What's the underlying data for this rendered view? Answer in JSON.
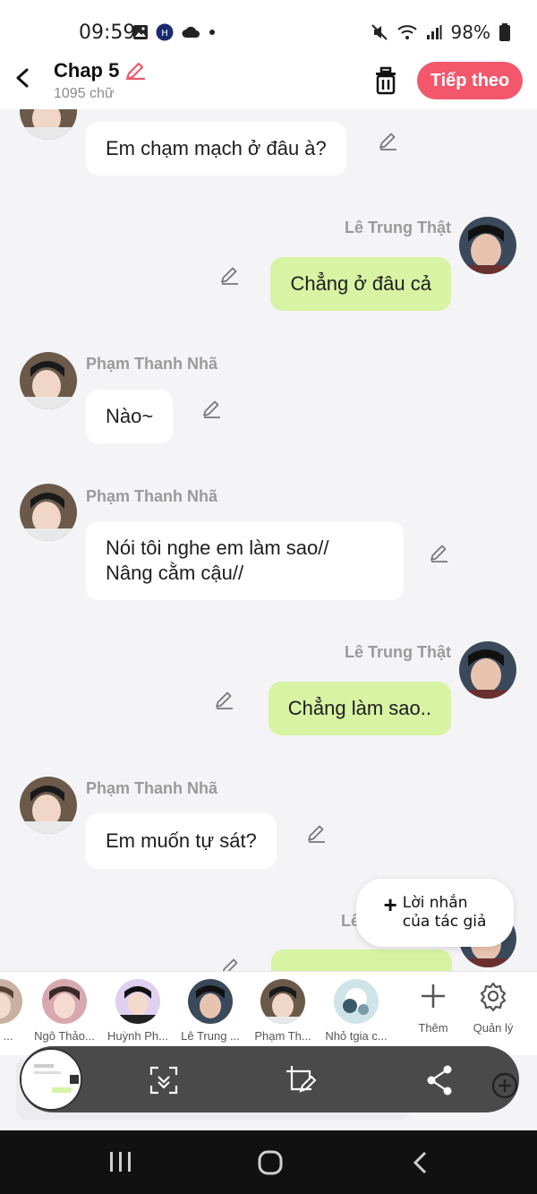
{
  "status_bar": {
    "time": "09:59",
    "battery": "98%"
  },
  "header": {
    "title": "Chap 5",
    "word_count": "1095 chữ",
    "next_button": "Tiếp theo"
  },
  "messages": [
    {
      "side": "left",
      "name": "",
      "text": "Em chạm mạch ở đâu à?"
    },
    {
      "side": "right",
      "name": "Lê Trung Thật",
      "text": "Chẳng ở đâu cả"
    },
    {
      "side": "left",
      "name": "Phạm Thanh Nhã",
      "text": "Nào~"
    },
    {
      "side": "left",
      "name": "Phạm Thanh Nhã",
      "text_line1": "Nói tôi nghe em làm sao//",
      "text_line2": "Nâng cằm cậu//"
    },
    {
      "side": "right",
      "name": "Lê Trung Thật",
      "text": "Chẳng làm sao.."
    },
    {
      "side": "left",
      "name": "Phạm Thanh Nhã",
      "text": "Em muốn tự sát?"
    },
    {
      "side": "right",
      "name": "Lê",
      "text": ""
    }
  ],
  "author_note": {
    "line1": "Lời nhắn",
    "line2": "của tác giả"
  },
  "characters": [
    {
      "label": "Lê ..."
    },
    {
      "label": "Ngô Thảo..."
    },
    {
      "label": "Huỳnh Ph..."
    },
    {
      "label": "Lê Trung ..."
    },
    {
      "label": "Phạm Th..."
    },
    {
      "label": "Nhỏ tgia c..."
    }
  ],
  "tools": {
    "add": "Thêm",
    "manage": "Quản lý"
  },
  "colors": {
    "accent": "#f2576c",
    "bubble_right": "#d7f3a3",
    "bubble_left": "#ffffff",
    "background": "#f4f4f6"
  }
}
